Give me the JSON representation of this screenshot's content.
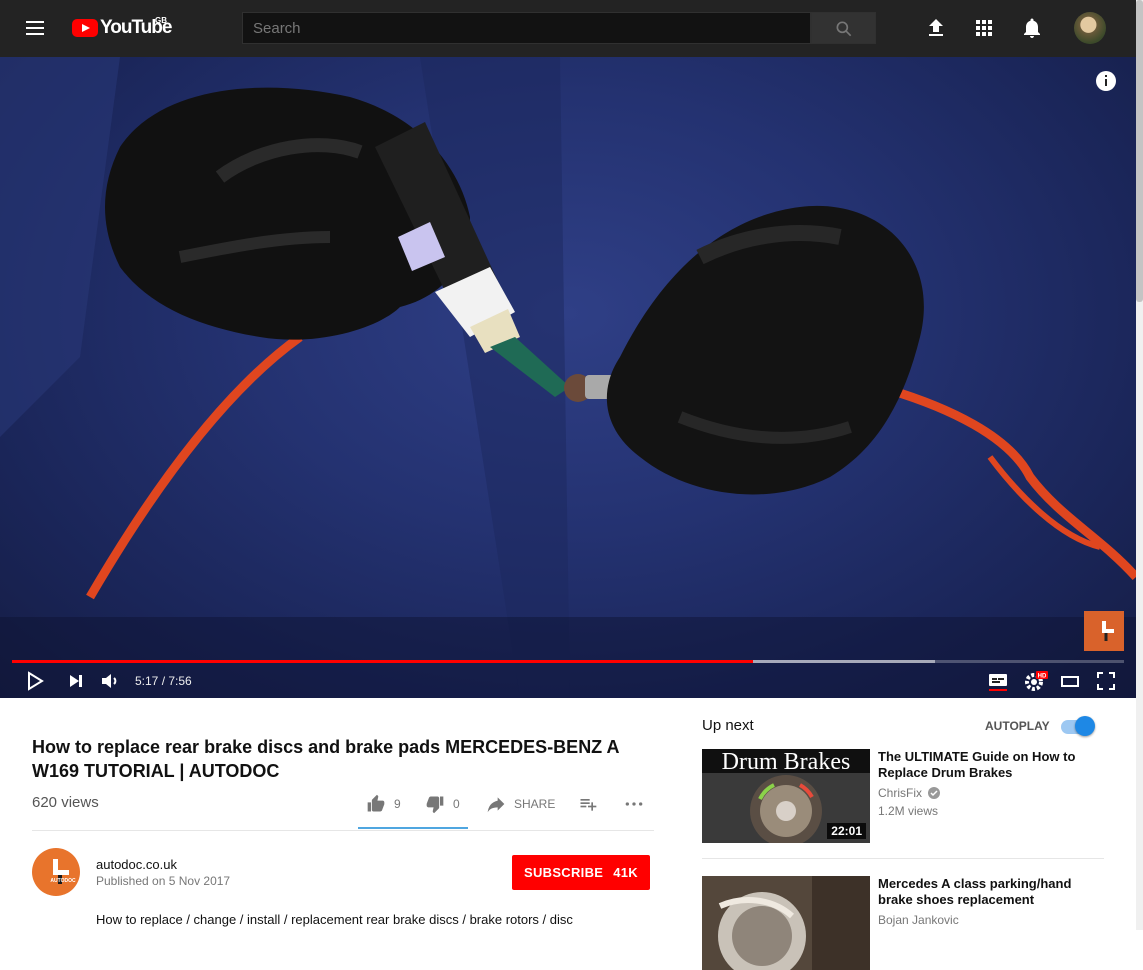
{
  "header": {
    "logo_text": "YouTube",
    "region": "GB",
    "search_placeholder": "Search",
    "icons": [
      "menu-icon",
      "search-icon",
      "upload-icon",
      "apps-icon",
      "bell-icon",
      "avatar"
    ]
  },
  "player": {
    "time": "5:17 / 7:56",
    "played_fraction": 0.666,
    "buffered_fraction": 0.83,
    "icons": [
      "info-icon",
      "play-icon",
      "next-icon",
      "volume-icon",
      "subtitles-icon",
      "settings-icon",
      "theater-icon",
      "fullscreen-icon"
    ],
    "hd_badge": "HD",
    "accent": "#ff0000"
  },
  "video": {
    "title": "How to replace rear brake discs and brake pads MERCEDES-BENZ A W169 TUTORIAL | AUTODOC",
    "views": "620 views",
    "likes": "9",
    "dislikes": "0",
    "share_label": "SHARE",
    "owner_name": "autodoc.co.uk",
    "published": "Published on 5 Nov 2017",
    "subscribe_label": "SUBSCRIBE",
    "subscriber_count": "41K",
    "description": "How to replace / change / install / replacement rear brake discs / brake rotors / disc",
    "logo_text": "AUTODOC"
  },
  "sidebar": {
    "up_next_label": "Up next",
    "autoplay_label": "AUTOPLAY",
    "autoplay_on": true,
    "items": [
      {
        "thumb_text": "Drum Brakes",
        "duration": "22:01",
        "title": "The ULTIMATE Guide on How to Replace Drum Brakes",
        "channel": "ChrisFix",
        "views": "1.2M views"
      },
      {
        "title": "Mercedes A class parking/hand brake shoes replacement",
        "channel": "Bojan Jankovic"
      }
    ]
  },
  "colors": {
    "topbar": "#232323",
    "subscribe": "#ff0000",
    "autoplay_toggle": "#1e88e5",
    "sentiment": "#4fa6e0"
  }
}
